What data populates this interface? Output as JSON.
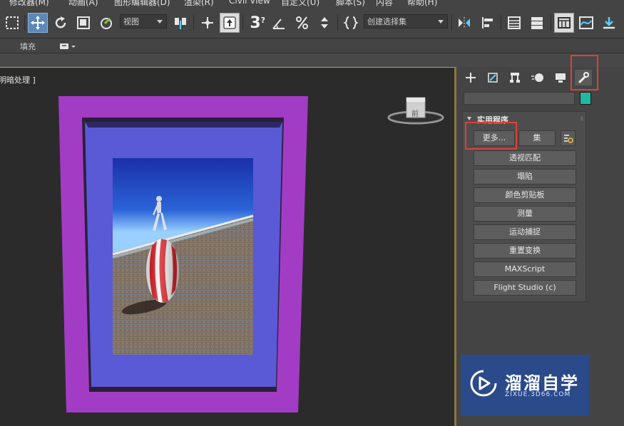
{
  "menu": [
    {
      "label": "修改器(M)"
    },
    {
      "label": "动画(A)"
    },
    {
      "label": "图形编辑器(D)"
    },
    {
      "label": "渲染(R)"
    },
    {
      "label": "Civil View"
    },
    {
      "label": "自定义(U)"
    },
    {
      "label": "脚本(S)"
    },
    {
      "label": "内容"
    },
    {
      "label": "帮助(H)"
    }
  ],
  "toolbar": {
    "reference_coord": "视图",
    "selection_set": "创建选择集",
    "snap_count": "3"
  },
  "ribbon": {
    "fill_label": "填充"
  },
  "viewport": {
    "label": "明暗处理 ]",
    "viewcube_label": "前"
  },
  "command_panel": {
    "tabs": [
      "create",
      "modify",
      "hierarchy",
      "motion",
      "display",
      "utilities"
    ],
    "active_tab": "utilities",
    "name_value": "",
    "swatch_color": "#21b89f",
    "rollout": {
      "title": "实用程序",
      "more_button": "更多...",
      "sets_button": "集",
      "utilities": [
        "透视匹配",
        "塌陷",
        "颜色剪贴板",
        "测量",
        "运动捕捉",
        "重置变换",
        "MAXScript",
        "Flight Studio (c)"
      ]
    }
  },
  "watermark": {
    "title": "溜溜自学",
    "url": "ZIXUE.3D66.COM"
  },
  "colors": {
    "highlight": "#e0403a",
    "active_tool": "#5b88b8",
    "frame_outer": "#a33cc4",
    "frame_inner": "#5a59d6"
  }
}
